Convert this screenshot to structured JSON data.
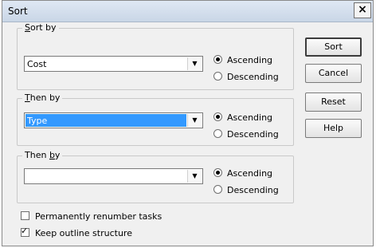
{
  "dialog": {
    "title": "Sort",
    "close_glyph": "✕"
  },
  "sort_by": {
    "label": "Sort by",
    "value": "Cost",
    "ascending": "Ascending",
    "descending": "Descending",
    "selected": "ascending"
  },
  "then_by_1": {
    "label": "Then by",
    "value": "Type",
    "ascending": "Ascending",
    "descending": "Descending",
    "selected": "ascending"
  },
  "then_by_2": {
    "label": "Then by",
    "value": "",
    "ascending": "Ascending",
    "descending": "Descending",
    "selected": "ascending"
  },
  "buttons": {
    "sort": "Sort",
    "cancel": "Cancel",
    "reset": "Reset",
    "help": "Help"
  },
  "options": {
    "renumber": {
      "label": "Permanently renumber tasks",
      "checked": false
    },
    "outline": {
      "label": "Keep outline structure",
      "checked": true
    }
  }
}
